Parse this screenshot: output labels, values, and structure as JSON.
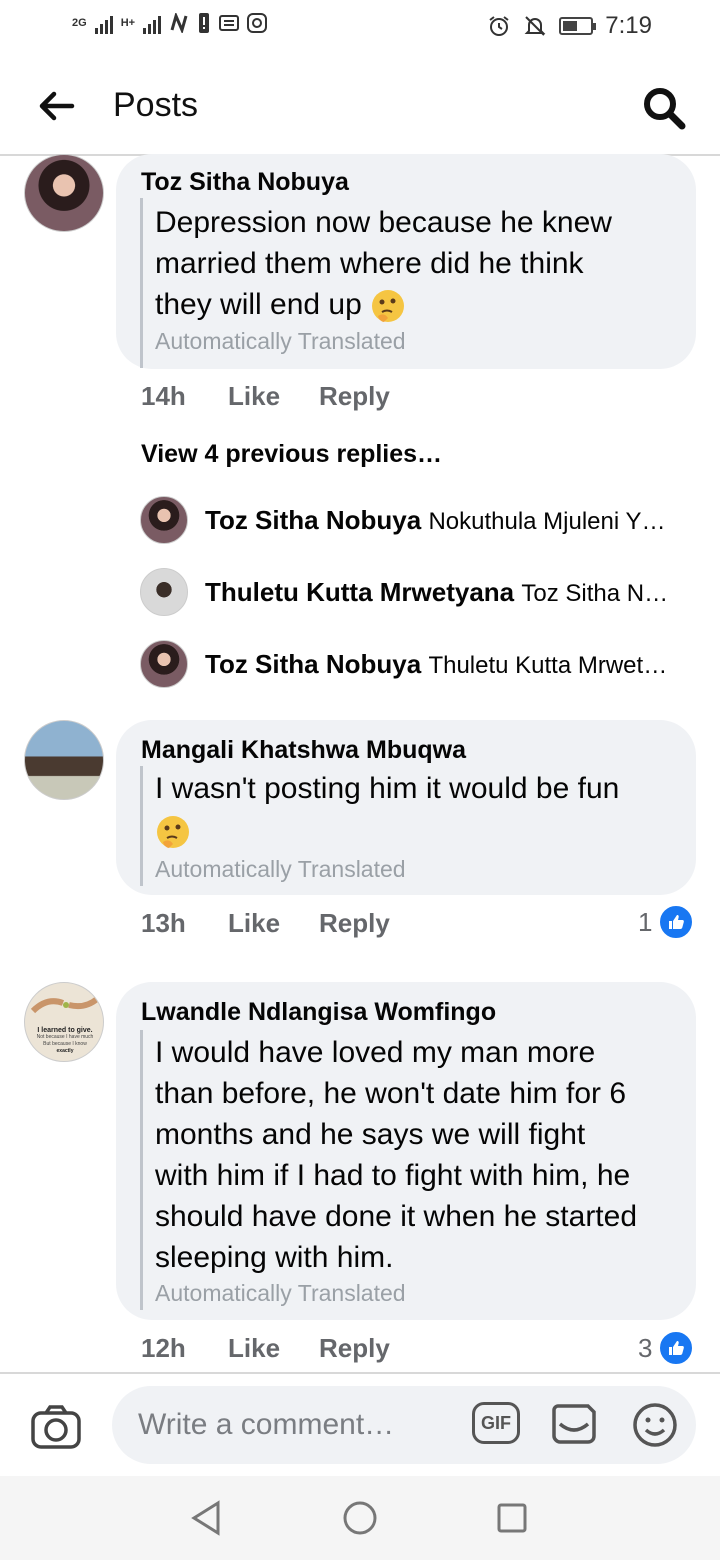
{
  "status_bar": {
    "network_1": "2G",
    "network_2": "H+",
    "time": "7:19",
    "battery_level": 0.5
  },
  "header": {
    "title": "Posts"
  },
  "comments": [
    {
      "author": "Toz Sitha Nobuya",
      "lines": [
        "Depression now because he knew",
        "married them where did he think",
        "they will end up"
      ],
      "emoji": "thinking-face",
      "translated_label": "Automatically Translated",
      "time": "14h",
      "like_label": "Like",
      "reply_label": "Reply",
      "view_previous": "View 4 previous replies…",
      "replies": [
        {
          "author": "Toz Sitha Nobuya",
          "preview": "Nokuthula Mjuleni  Y…"
        },
        {
          "author": "Thuletu Kutta Mrwetyana",
          "preview": "Toz Sitha N…"
        },
        {
          "author": "Toz Sitha Nobuya",
          "preview": "Thuletu Kutta Mrwet…"
        }
      ]
    },
    {
      "author": "Mangali Khatshwa Mbuqwa",
      "lines": [
        "I wasn't posting him it would be fun"
      ],
      "emoji": "thinking-face",
      "translated_label": "Automatically Translated",
      "time": "13h",
      "like_label": "Like",
      "reply_label": "Reply",
      "like_count": "1"
    },
    {
      "author": "Lwandle Ndlangisa Womfingo",
      "avatar_lines": [
        "I learned to give.",
        "Not because I have much",
        "But because I know",
        "exactly"
      ],
      "lines": [
        "I would have loved my man more",
        "than before, he won't date him for 6",
        "months and he says we will fight",
        "with him if I had to fight with him, he",
        "should have done it when he started",
        "sleeping with him."
      ],
      "translated_label": "Automatically Translated",
      "time": "12h",
      "like_label": "Like",
      "reply_label": "Reply",
      "like_count": "3"
    }
  ],
  "composer": {
    "placeholder": "Write a comment…",
    "gif_label": "GIF"
  },
  "colors": {
    "bubble": "#f0f2f5",
    "like_blue": "#1877f2",
    "meta_gray": "#65676b"
  }
}
